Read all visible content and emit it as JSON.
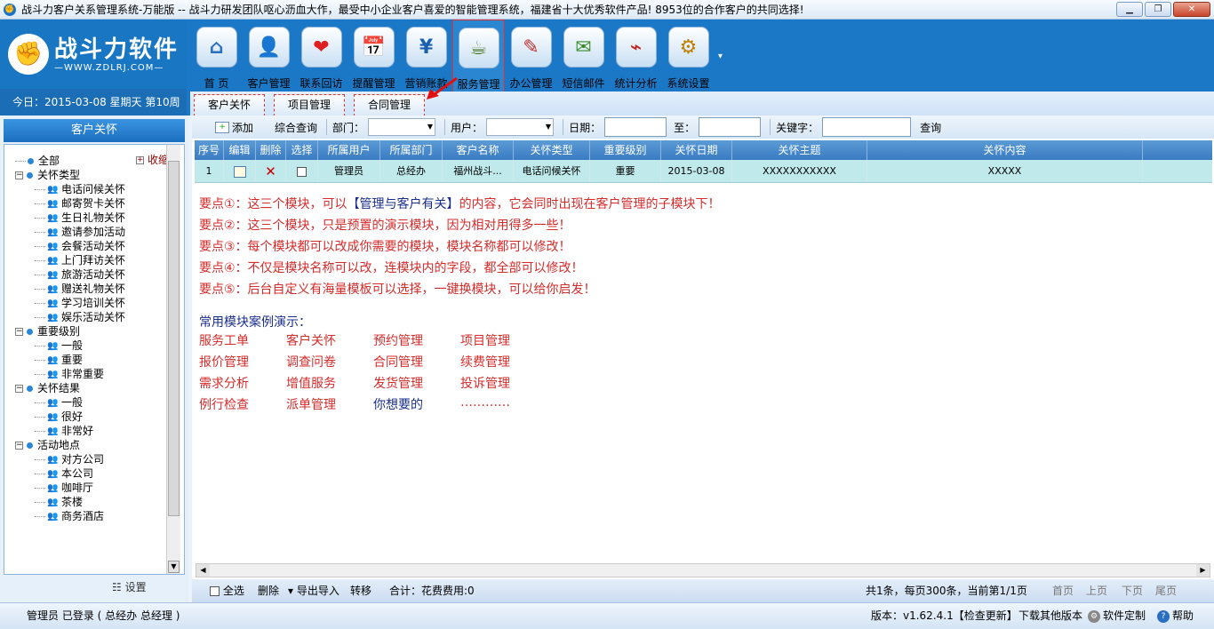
{
  "window": {
    "title": "战斗力客户关系管理系统-万能版 -- 战斗力研发团队呕心沥血大作，最受中小企业客户喜爱的智能管理系统，福建省十大优秀软件产品! 8953位的合作客户的共同选择!",
    "minimize": "▁",
    "restore": "❐",
    "close": "✕"
  },
  "logo": {
    "brand": "战斗力软件",
    "url": "—WWW.ZDLRJ.COM—",
    "mark": "✊"
  },
  "date_line": "今日：2015-03-08  星期天  第10周",
  "toolbar": [
    {
      "label": "首 页",
      "glyph": "⌂",
      "color": "#2a6fc2"
    },
    {
      "label": "客户管理",
      "glyph": "👤",
      "color": "#d08a00"
    },
    {
      "label": "联系回访",
      "glyph": "❤",
      "color": "#e02020"
    },
    {
      "label": "提醒管理",
      "glyph": "📅",
      "color": "#2a8a2a"
    },
    {
      "label": "营销账款",
      "glyph": "¥",
      "color": "#1a5fb0"
    },
    {
      "label": "服务管理",
      "glyph": "☕",
      "color": "#4a7a2a"
    },
    {
      "label": "办公管理",
      "glyph": "✎",
      "color": "#c03030"
    },
    {
      "label": "短信邮件",
      "glyph": "✉",
      "color": "#3a8a2a"
    },
    {
      "label": "统计分析",
      "glyph": "⌁",
      "color": "#c02020"
    },
    {
      "label": "系统设置",
      "glyph": "⚙",
      "color": "#c08000"
    }
  ],
  "subtabs": [
    "客户关怀",
    "项目管理",
    "合同管理"
  ],
  "sidebar": {
    "title": "客户关怀",
    "collapse": "收缩",
    "settings": "设置",
    "tree": [
      {
        "label": "全部",
        "level": 0,
        "type": "leafroot"
      },
      {
        "label": "关怀类型",
        "level": 0,
        "type": "group"
      },
      {
        "label": "电话问候关怀",
        "level": 1
      },
      {
        "label": "邮寄贺卡关怀",
        "level": 1
      },
      {
        "label": "生日礼物关怀",
        "level": 1
      },
      {
        "label": "邀请参加活动",
        "level": 1
      },
      {
        "label": "会餐活动关怀",
        "level": 1
      },
      {
        "label": "上门拜访关怀",
        "level": 1
      },
      {
        "label": "旅游活动关怀",
        "level": 1
      },
      {
        "label": "赠送礼物关怀",
        "level": 1
      },
      {
        "label": "学习培训关怀",
        "level": 1
      },
      {
        "label": "娱乐活动关怀",
        "level": 1
      },
      {
        "label": "重要级别",
        "level": 0,
        "type": "group"
      },
      {
        "label": "一般",
        "level": 1
      },
      {
        "label": "重要",
        "level": 1
      },
      {
        "label": "非常重要",
        "level": 1
      },
      {
        "label": "关怀结果",
        "level": 0,
        "type": "group"
      },
      {
        "label": "一般",
        "level": 1
      },
      {
        "label": "很好",
        "level": 1
      },
      {
        "label": "非常好",
        "level": 1
      },
      {
        "label": "活动地点",
        "level": 0,
        "type": "group"
      },
      {
        "label": "对方公司",
        "level": 1
      },
      {
        "label": "本公司",
        "level": 1
      },
      {
        "label": "咖啡厅",
        "level": 1
      },
      {
        "label": "茶楼",
        "level": 1
      },
      {
        "label": "商务酒店",
        "level": 1
      }
    ]
  },
  "filter": {
    "add": "添加",
    "combined_query": "综合查询",
    "dept_label": "部门：",
    "user_label": "用户：",
    "date_label": "日期：",
    "to_label": "至：",
    "keyword_label": "关键字：",
    "query": "查询"
  },
  "table": {
    "columns": [
      "序号",
      "编辑",
      "删除",
      "选择",
      "所属用户",
      "所属部门",
      "客户名称",
      "关怀类型",
      "重要级别",
      "关怀日期",
      "关怀主题",
      "关怀内容"
    ],
    "rows": [
      [
        "1",
        "",
        "",
        "",
        "管理员",
        "总经办",
        "福州战斗...",
        "电话问候关怀",
        "重要",
        "2015-03-08",
        "XXXXXXXXXXX",
        "XXXXX"
      ]
    ]
  },
  "tips": [
    {
      "prefix": "要点①：这三个模块，可以",
      "highlight": "【管理与客户有关】",
      "suffix": "的内容，它会同时出现在客户管理的子模块下！"
    },
    {
      "prefix": "要点②：这三个模块，只是预置的演示模块，因为相对用得多一些！",
      "highlight": "",
      "suffix": ""
    },
    {
      "prefix": "要点③：每个模块都可以改成你需要的模块，模块名称都可以修改！",
      "highlight": "",
      "suffix": ""
    },
    {
      "prefix": "要点④：不仅是模块名称可以改，连模块内的字段，都全部可以修改！",
      "highlight": "",
      "suffix": ""
    },
    {
      "prefix": "要点⑤：后台自定义有海量模板可以选择，一键换模块，可以给你启发！",
      "highlight": "",
      "suffix": ""
    }
  ],
  "common_title": "常用模块案例演示：",
  "modules": [
    [
      "服务工单",
      "客户关怀",
      "预约管理",
      "项目管理"
    ],
    [
      "报价管理",
      "调查问卷",
      "合同管理",
      "续费管理"
    ],
    [
      "需求分析",
      "增值服务",
      "发货管理",
      "投诉管理"
    ],
    [
      "例行检查",
      "派单管理",
      "你想要的",
      "…………"
    ]
  ],
  "pager": {
    "select_all": "全选",
    "delete": "删除",
    "export": "导出导入",
    "transfer": "转移",
    "total": "合计：花费费用:0",
    "summary": "共1条，每页300条，当前第1/1页",
    "first": "首页",
    "prev": "上页",
    "next": "下页",
    "last": "尾页"
  },
  "status": {
    "user": "管理员 已登录 ( 总经办 总经理 )",
    "version": "版本：v1.62.4.1【检查更新】",
    "download": "下载其他版本",
    "customize": "软件定制",
    "help": "帮助"
  }
}
